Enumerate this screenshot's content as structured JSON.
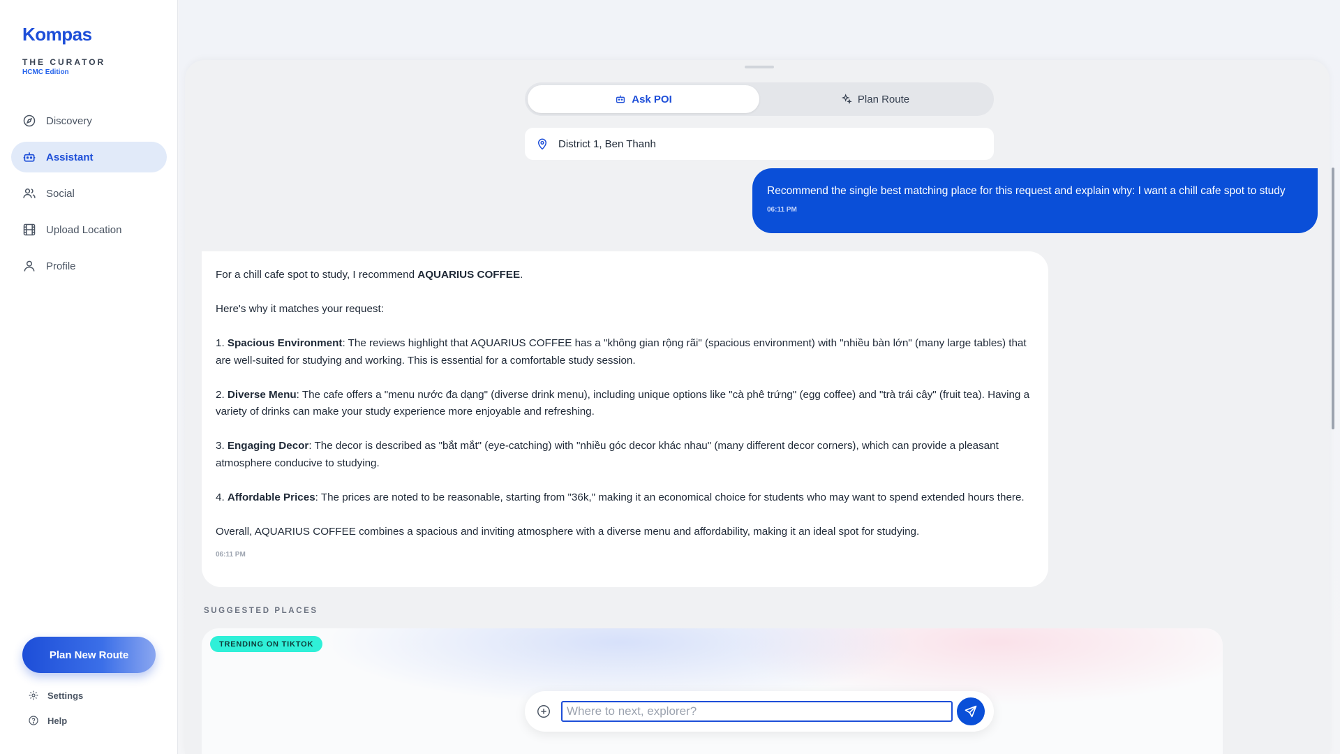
{
  "sidebar": {
    "brand": "Kompas",
    "subtitle": "THE CURATOR",
    "edition": "HCMC Edition",
    "items": [
      {
        "label": "Discovery",
        "icon": "compass-icon",
        "active": false
      },
      {
        "label": "Assistant",
        "icon": "robot-icon",
        "active": true
      },
      {
        "label": "Social",
        "icon": "users-icon",
        "active": false
      },
      {
        "label": "Upload Location",
        "icon": "film-icon",
        "active": false
      },
      {
        "label": "Profile",
        "icon": "user-icon",
        "active": false
      }
    ],
    "plan_button": "Plan New Route",
    "settings": "Settings",
    "help": "Help"
  },
  "mode_toggle": {
    "ask_poi": "Ask POI",
    "plan_route": "Plan Route",
    "active": "ask_poi"
  },
  "location": "District 1, Ben Thanh",
  "conversation": {
    "user": {
      "text": "Recommend the single best matching place for this request and explain why: I want a chill cafe spot to study",
      "time": "06:11 PM"
    },
    "assistant": {
      "intro_pre": "For a chill cafe spot to study, I recommend ",
      "intro_bold": "AQUARIUS COFFEE",
      "intro_post": ".",
      "why": "Here's why it matches your request:",
      "points": [
        {
          "num": "1. ",
          "title": "Spacious Environment",
          "text": ": The reviews highlight that AQUARIUS COFFEE has a \"không gian rộng rãi\" (spacious environment) with \"nhiều bàn lớn\" (many large tables) that are well-suited for studying and working. This is essential for a comfortable study session."
        },
        {
          "num": "2. ",
          "title": "Diverse Menu",
          "text": ": The cafe offers a \"menu nước đa dạng\" (diverse drink menu), including unique options like \"cà phê trứng\" (egg coffee) and \"trà trái cây\" (fruit tea). Having a variety of drinks can make your study experience more enjoyable and refreshing."
        },
        {
          "num": "3. ",
          "title": "Engaging Decor",
          "text": ": The decor is described as \"bắt mắt\" (eye-catching) with \"nhiều góc decor khác nhau\" (many different decor corners), which can provide a pleasant atmosphere conducive to studying."
        },
        {
          "num": "4. ",
          "title": "Affordable Prices",
          "text": ": The prices are noted to be reasonable, starting from \"36k,\" making it an economical choice for students who may want to spend extended hours there."
        }
      ],
      "summary": "Overall, AQUARIUS COFFEE combines a spacious and inviting atmosphere with a diverse menu and affordability, making it an ideal spot for studying.",
      "time": "06:11 PM"
    }
  },
  "suggested": {
    "label": "SUGGESTED PLACES",
    "badge": "TRENDING ON TIKTOK"
  },
  "composer": {
    "placeholder": "Where to next, explorer?",
    "value": ""
  },
  "colors": {
    "brand": "#1d4ed8",
    "user_bubble": "#0a4fd8",
    "badge": "#2ff0d8"
  }
}
